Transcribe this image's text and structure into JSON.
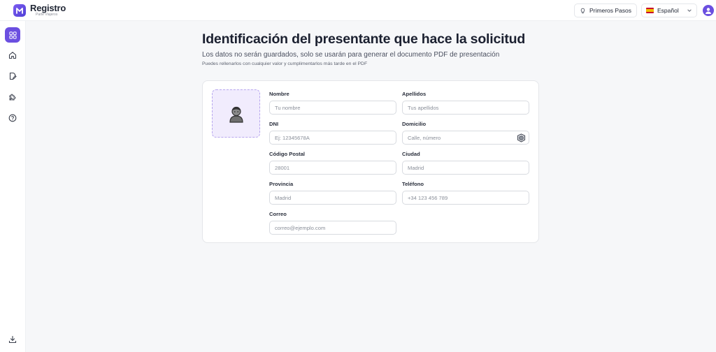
{
  "app": {
    "title": "Registro",
    "subtitle": "Parte Viajeros"
  },
  "header": {
    "primeros_pasos_label": "Primeros Pasos",
    "language_selected": "Español"
  },
  "sidebar": {
    "items": [
      {
        "icon": "grid-icon",
        "active": true
      },
      {
        "icon": "home-icon",
        "active": false
      },
      {
        "icon": "document-edit-icon",
        "active": false
      },
      {
        "icon": "puzzle-icon",
        "active": false
      },
      {
        "icon": "help-circle-icon",
        "active": false
      }
    ],
    "bottom_icon": "download-icon"
  },
  "page": {
    "title": "Identificación del presentante que hace la solicitud",
    "subtitle": "Los datos no serán guardados, solo se usarán para generar el documento PDF de presentación",
    "hint": "Puedes rellenarlos con cualquier valor y cumplimentarlos más tarde en el PDF"
  },
  "form": {
    "nombre": {
      "label": "Nombre",
      "placeholder": "Tu nombre"
    },
    "apellidos": {
      "label": "Apellidos",
      "placeholder": "Tus apellidos"
    },
    "dni": {
      "label": "DNI",
      "placeholder": "Ej: 12345678A"
    },
    "domicilio": {
      "label": "Domicilio",
      "placeholder": "Calle, número"
    },
    "codigo_postal": {
      "label": "Código Postal",
      "placeholder": "28001"
    },
    "ciudad": {
      "label": "Ciudad",
      "placeholder": "Madrid"
    },
    "provincia": {
      "label": "Provincia",
      "placeholder": "Madrid"
    },
    "telefono": {
      "label": "Teléfono",
      "placeholder": "+34 123 456 789"
    },
    "correo": {
      "label": "Correo",
      "placeholder": "correo@ejemplo.com"
    }
  },
  "colors": {
    "accent": "#6b4fe0",
    "photo_bg": "#f1ecfd",
    "background": "#f6f7f9"
  }
}
